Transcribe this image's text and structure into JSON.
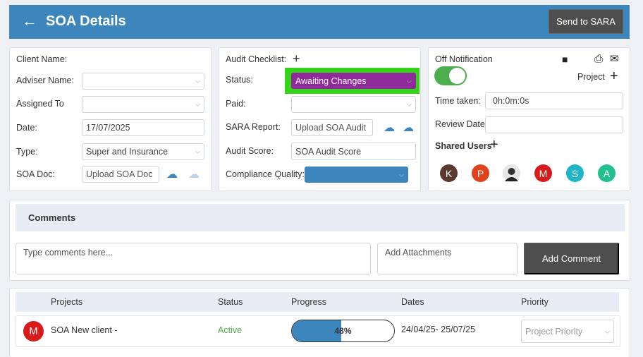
{
  "header": {
    "back": "←",
    "title": "SOA Details",
    "send_label": "Send to SARA"
  },
  "left": {
    "client_label": "Client Name:",
    "adviser_label": "Adviser Name:",
    "assigned_label": "Assigned To",
    "date_label": "Date:",
    "date_value": "17/07/2025",
    "type_label": "Type:",
    "type_value": "Super and Insurance",
    "soadoc_label": "SOA Doc:",
    "soadoc_upload": "Upload SOA Doc"
  },
  "middle": {
    "checklist_label": "Audit Checklist:",
    "status_label": "Status:",
    "status_value": "Awaiting Changes",
    "paid_label": "Paid:",
    "sara_label": "SARA Report:",
    "sara_upload": "Upload SOA Audit",
    "score_label": "Audit Score:",
    "score_value": "SOA Audit Score",
    "compliance_label": "Compliance Quality:"
  },
  "right": {
    "off_notification": "Off Notification",
    "project_label": "Project",
    "time_label": "Time taken:",
    "time_value": "0h:0m:0s",
    "review_label": "Review Date:",
    "shared_label": "Shared Users",
    "users": [
      {
        "initial": "K",
        "color": "#5a3a2e"
      },
      {
        "initial": "P",
        "color": "#e0421a"
      },
      {
        "initial": "",
        "color": "#cfcfcf"
      },
      {
        "initial": "M",
        "color": "#d71b1b"
      },
      {
        "initial": "S",
        "color": "#1eb5c9"
      },
      {
        "initial": "A",
        "color": "#22c08f"
      }
    ]
  },
  "comments": {
    "title": "Comments",
    "placeholder": "Type comments here...",
    "attach": "Add Attachments",
    "add_label": "Add Comment"
  },
  "projects": {
    "headers": [
      "Projects",
      "Status",
      "Progress",
      "Dates",
      "Priority"
    ],
    "row": {
      "avatar": "M",
      "name": "SOA New client -",
      "status": "Active",
      "progress_text": "48%",
      "progress": 0.48,
      "dates": "24/04/25- 25/07/25",
      "priority_placeholder": "Project Priority"
    }
  },
  "colors": {
    "accent": "#3c86bd",
    "status_bg": "#8e2a9a",
    "status_border": "#35d31a",
    "active": "#4cae4c"
  }
}
